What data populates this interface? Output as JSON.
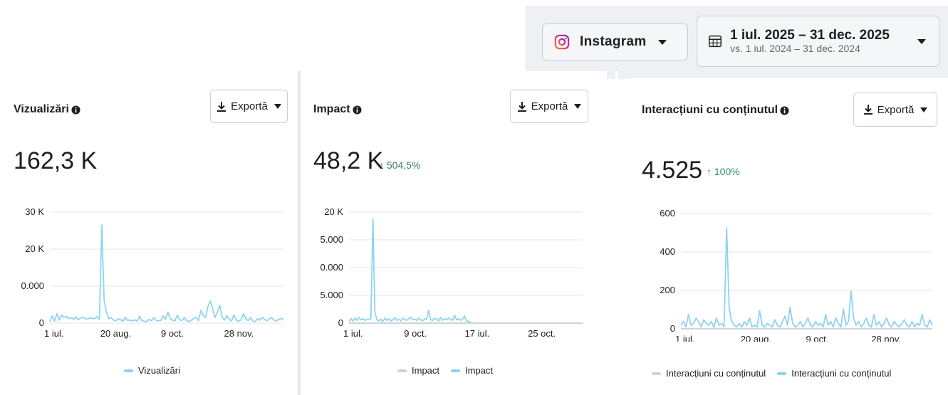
{
  "filters": {
    "platform": {
      "label": "Instagram",
      "icon": "instagram-icon"
    },
    "date_range": {
      "main": "1 iul. 2025 – 31 dec. 2025",
      "compare": "vs. 1 iul. 2024 – 31 dec. 2024",
      "icon": "calendar-icon"
    }
  },
  "export_label": "Exportă",
  "colors": {
    "series": "#8fd3f0",
    "compare": "#cfd3d8",
    "grid": "#e4e6eb",
    "positive": "#2e8b57"
  },
  "panels": [
    {
      "title": "Vizualizări",
      "value": "162,3 K",
      "delta": ""
    },
    {
      "title": "Impact",
      "value": "48,2 K",
      "delta": "↑ 504,5%"
    },
    {
      "title": "Interacțiuni cu conținutul",
      "value": "4.525",
      "delta": "↑ 100%"
    }
  ],
  "chart_data": [
    {
      "type": "line",
      "title": "Vizualizări",
      "y_ticks": [
        "30 K",
        "20 K",
        "0.000",
        "0"
      ],
      "x_ticks": [
        "1 iul.",
        "20 aug.",
        "9 oct.",
        "28 nov."
      ],
      "legend": [
        "Vizualizări"
      ],
      "series": [
        {
          "name": "Vizualizări",
          "values": [
            300,
            2000,
            500,
            2500,
            800,
            2200,
            1500,
            1800,
            1200,
            1500,
            1000,
            1700,
            900,
            1300,
            1600,
            1200,
            1000,
            1400,
            1300,
            1200,
            1800,
            1000,
            26500,
            6000,
            3000,
            1200,
            1500,
            800,
            600,
            1200,
            900,
            500,
            1600,
            700,
            800,
            600,
            900,
            500,
            1800,
            700,
            500,
            400,
            1000,
            600,
            1500,
            800,
            600,
            700,
            2000,
            1000,
            3000,
            1200,
            800,
            600,
            2200,
            900,
            700,
            1500,
            600,
            400,
            800,
            1300,
            1600,
            700,
            3500,
            2000,
            1500,
            4500,
            6000,
            4000,
            1500,
            3000,
            4800,
            1500,
            800,
            2000,
            1000,
            600,
            2200,
            800,
            500,
            900,
            2500,
            1200,
            700,
            1500,
            600,
            400,
            1200,
            800,
            1600,
            1000,
            600,
            1200,
            1500,
            800,
            600,
            1000,
            1300,
            900
          ]
        }
      ],
      "ylim": [
        0,
        30000
      ],
      "grid": true,
      "legend_position": "bottom"
    },
    {
      "type": "line",
      "title": "Impact",
      "y_ticks": [
        "20 K",
        "5.000",
        "0.000",
        "5.000",
        "0"
      ],
      "x_ticks": [
        "1 iul.",
        "9 oct.",
        "17 iul.",
        "25 oct."
      ],
      "legend": [
        "Impact",
        "Impact"
      ],
      "series": [
        {
          "name": "Impact",
          "values": [
            0,
            0,
            0,
            0,
            0,
            0,
            0,
            0,
            0,
            0,
            0,
            0,
            0,
            0,
            0,
            0,
            0,
            0,
            0,
            0,
            0,
            0,
            0,
            0,
            0,
            0,
            0,
            0,
            0,
            0,
            0,
            0,
            0,
            0,
            0,
            0,
            0,
            0,
            0,
            0,
            0,
            0,
            0,
            0,
            0,
            0,
            0,
            0,
            0,
            0,
            0,
            0,
            0,
            0,
            0,
            0,
            0,
            0,
            0,
            0,
            0,
            0,
            0,
            0,
            0,
            0,
            0,
            0,
            0,
            0,
            0,
            0,
            0,
            0,
            0,
            0,
            0,
            0,
            0,
            0,
            0,
            0,
            0,
            0,
            0,
            0,
            0,
            0,
            0,
            0,
            0,
            0,
            0,
            0,
            0,
            0,
            0,
            0,
            0,
            0
          ]
        },
        {
          "name": "Impact",
          "values": [
            300,
            800,
            400,
            900,
            500,
            1000,
            600,
            800,
            500,
            700,
            600,
            900,
            18800,
            2000,
            600,
            400,
            700,
            300,
            900,
            500,
            800,
            400,
            600,
            1000,
            500,
            700,
            400,
            900,
            600,
            500,
            800,
            1100,
            600,
            700,
            500,
            900,
            600,
            400,
            800,
            700,
            2300,
            600,
            500,
            900,
            700,
            400,
            1000,
            500,
            800,
            600,
            900,
            700,
            500,
            1400,
            600,
            800,
            500,
            700,
            1300,
            400,
            300,
            200
          ]
        }
      ],
      "ylim": [
        0,
        20000
      ],
      "grid": true,
      "legend_position": "bottom"
    },
    {
      "type": "line",
      "title": "Interacțiuni cu conținutul",
      "y_ticks": [
        "600",
        "400",
        "200",
        "0"
      ],
      "x_ticks": [
        "1 iul.",
        "20 aug.",
        "9 oct.",
        "28 nov."
      ],
      "legend": [
        "Interacțiuni cu conținutul",
        "Interacțiuni cu conținutul"
      ],
      "series": [
        {
          "name": "Interacțiuni cu conținutul",
          "values": [
            0,
            0,
            0,
            0,
            0,
            0,
            0,
            0,
            0,
            0,
            0,
            0,
            0,
            0,
            0,
            0,
            0,
            0,
            0,
            0,
            0,
            0,
            0,
            0,
            0,
            0,
            0,
            0,
            0,
            0,
            0,
            0,
            0,
            0,
            0,
            0,
            0,
            0,
            0,
            0,
            0,
            0,
            0,
            0,
            0,
            0,
            0,
            0,
            0,
            0,
            0,
            0,
            0,
            0,
            0,
            0,
            0,
            0,
            0,
            0,
            0,
            0,
            0,
            0,
            0,
            0,
            0,
            0,
            0,
            0,
            0,
            0,
            0,
            0,
            0,
            0,
            0,
            0,
            0,
            0,
            0,
            0,
            0,
            0,
            0,
            0,
            0,
            0,
            0,
            0,
            0,
            0,
            0,
            0,
            0,
            0,
            0,
            0,
            0,
            0
          ]
        },
        {
          "name": "Interacțiuni cu conținutul",
          "values": [
            20,
            40,
            10,
            80,
            20,
            30,
            60,
            40,
            10,
            50,
            30,
            20,
            40,
            10,
            60,
            20,
            30,
            10,
            560,
            120,
            40,
            20,
            10,
            30,
            10,
            40,
            20,
            60,
            10,
            20,
            10,
            100,
            20,
            10,
            30,
            20,
            10,
            50,
            20,
            10,
            40,
            70,
            20,
            120,
            30,
            10,
            20,
            40,
            10,
            30,
            60,
            20,
            10,
            40,
            20,
            30,
            10,
            80,
            20,
            40,
            10,
            60,
            30,
            10,
            110,
            20,
            40,
            210,
            60,
            20,
            40,
            10,
            30,
            60,
            20,
            10,
            80,
            20,
            40,
            10,
            30,
            60,
            20,
            10,
            40,
            20,
            10,
            30,
            50,
            20,
            10,
            40,
            10,
            30,
            20,
            80,
            20,
            10,
            50,
            20
          ]
        }
      ],
      "ylim": [
        0,
        640
      ],
      "grid": true,
      "legend_position": "bottom"
    }
  ]
}
